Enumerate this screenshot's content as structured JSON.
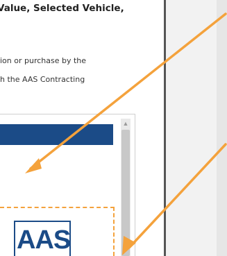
{
  "document": {
    "heading": "Value, Selected Vehicle,",
    "paragraph1": "ion or purchase by the",
    "paragraph2": "h the AAS Contracting"
  },
  "logo": {
    "text": "AAS"
  },
  "colors": {
    "accent_orange": "#f4a23c",
    "brand_blue": "#1b4b87"
  },
  "icons": {
    "scroll_up": "scroll-up-icon"
  }
}
